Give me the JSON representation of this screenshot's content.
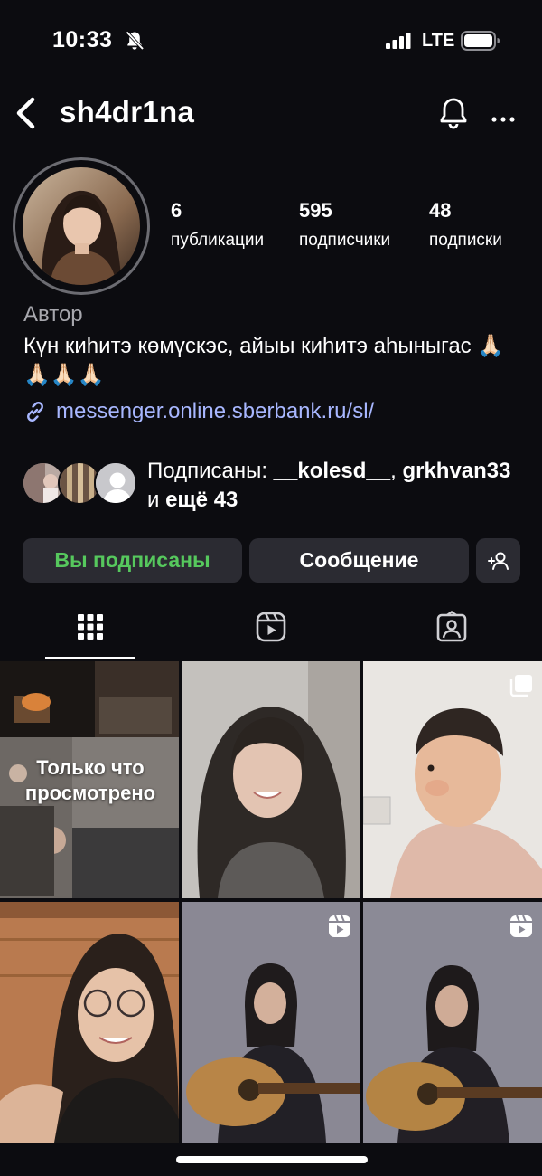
{
  "status_bar": {
    "time": "10:33",
    "network": "LTE"
  },
  "header": {
    "username": "sh4dr1na"
  },
  "profile": {
    "stats": [
      {
        "value": "6",
        "label": "публикации"
      },
      {
        "value": "595",
        "label": "подписчики"
      },
      {
        "value": "48",
        "label": "подписки"
      }
    ],
    "category": "Автор",
    "bio_text": "Күн киһитэ көмүскэс, айыы киһитэ аһыныгас",
    "bio_emoji": "🙏🏻🙏🏻🙏🏻🙏🏻",
    "link": "messenger.online.sberbank.ru/sl/"
  },
  "followed_by": {
    "prefix": "Подписаны: ",
    "user1": "__kolesd__",
    "separator": ",",
    "user2": "grkhvan33",
    "and_more_prefix": " и ",
    "and_more": "ещё 43"
  },
  "buttons": {
    "following": "Вы подписаны",
    "message": "Сообщение"
  },
  "tabs": [
    "grid-tab",
    "reels-tab",
    "tagged-tab"
  ],
  "grid": {
    "recently_viewed_label": "Только что просмотрено"
  },
  "colors": {
    "background": "#0c0c10",
    "button": "#2b2b32",
    "following_green": "#56c85d",
    "link": "#a8b7ff"
  }
}
